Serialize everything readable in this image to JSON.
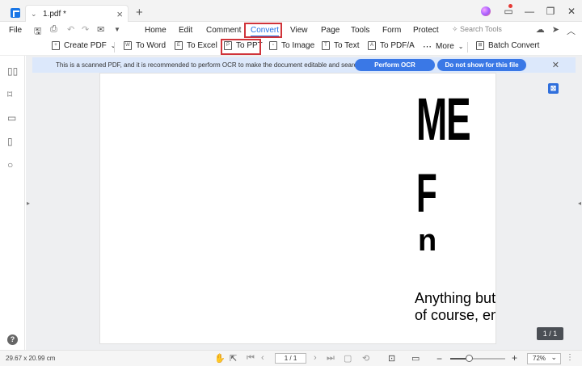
{
  "titlebar": {
    "tab_name": "1.pdf *",
    "tab_chevron": "⌄",
    "tab_close": "×",
    "new_tab": "+",
    "win_minimize": "—",
    "win_restore": "❐",
    "win_close": "✕"
  },
  "menubar": {
    "file": "File",
    "items": [
      "Home",
      "Edit",
      "Comment",
      "Convert",
      "View",
      "Page",
      "Tools",
      "Form",
      "Protect"
    ],
    "active": "Convert",
    "search_placeholder": "Search Tools"
  },
  "toolbar": {
    "create_pdf": "Create PDF",
    "to_word": "To Word",
    "to_excel": "To Excel",
    "to_ppt": "To PPT",
    "to_image": "To Image",
    "to_text": "To Text",
    "to_pdfa": "To PDF/A",
    "more": "More",
    "batch_convert": "Batch Convert"
  },
  "banner": {
    "message": "This is a scanned PDF, and it is recommended to perform OCR to make the document editable and searchable.",
    "perform_ocr": "Perform OCR",
    "dont_show": "Do not show for this file again.",
    "close": "✕"
  },
  "document": {
    "heading_line1": "ME",
    "heading_line2": "F",
    "heading_line3": "n",
    "text_line1": "Anything but c",
    "text_line2": "of course, emi"
  },
  "page_badge": "1 / 1",
  "statusbar": {
    "dimensions": "29.67 x 20.99 cm",
    "page_input": "1 / 1",
    "zoom_percent": 72,
    "zoom_label": "72%",
    "zoom_minus": "−",
    "zoom_plus": "+",
    "more": "⋮"
  },
  "colors": {
    "accent": "#1f6fe5",
    "banner_bg": "#dce8fb",
    "button_bg": "#3a78e6",
    "highlight_box": "#d0343a"
  }
}
